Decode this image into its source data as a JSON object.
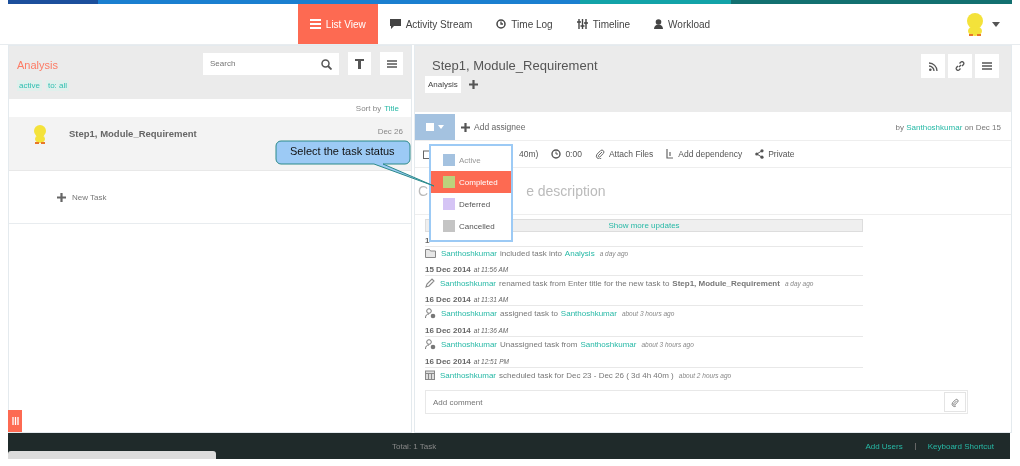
{
  "nav": {
    "tabs": [
      {
        "label": "List View",
        "selected": true
      },
      {
        "label": "Activity Stream",
        "selected": false
      },
      {
        "label": "Time Log",
        "selected": false
      },
      {
        "label": "Timeline",
        "selected": false
      },
      {
        "label": "Workload",
        "selected": false
      }
    ]
  },
  "list_panel": {
    "title": "Analysis",
    "search": {
      "placeholder": "Search"
    },
    "filters": [
      "active",
      "to: all"
    ],
    "sort": {
      "label": "Sort by",
      "value": "Title"
    },
    "tasks": [
      {
        "title": "Step1, Module_Requirement",
        "date": "Dec 26",
        "selected": true
      }
    ],
    "new_task": "New Task"
  },
  "task": {
    "title": "Step1, Module_Requirement",
    "tags": [
      "Analysis"
    ],
    "status_checked": false,
    "status_menu": {
      "items": [
        {
          "label": "Active",
          "color": "#a4c2e0",
          "selected": false
        },
        {
          "label": "Completed",
          "color": "#bcd27c",
          "selected": true
        },
        {
          "label": "Deferred",
          "color": "#d5c4f5",
          "selected": false
        },
        {
          "label": "Cancelled",
          "color": "#c4c4c4",
          "selected": false
        }
      ]
    },
    "add_assignee": "Add assignee",
    "created": {
      "prefix": "by",
      "user": "Santhoshkumar",
      "suffix": "on Dec 15"
    },
    "meta": [
      {
        "kind": "schedule",
        "label": "40m)"
      },
      {
        "kind": "time",
        "label": "0:00"
      },
      {
        "kind": "attach",
        "label": "Attach Files"
      },
      {
        "kind": "dependency",
        "label": "Add dependency"
      },
      {
        "kind": "private",
        "label": "Private"
      }
    ],
    "description_fragments": [
      "C",
      "e description"
    ],
    "show_more": "Show more updates",
    "activity": [
      {
        "date": "1",
        "kind": "folder",
        "parts": [
          {
            "kind": "user",
            "text": "Santhoshkumar"
          },
          {
            "kind": "text",
            "text": "included task into"
          },
          {
            "kind": "link",
            "text": "Analysis"
          },
          {
            "kind": "ago",
            "text": "a day ago"
          }
        ]
      },
      {
        "date": "15 Dec 2014",
        "time": "at 11:56 AM",
        "kind": "pencil",
        "parts": [
          {
            "kind": "user",
            "text": "Santhoshkumar"
          },
          {
            "kind": "text",
            "text": "renamed task from Enter title for the new task to"
          },
          {
            "kind": "bold",
            "text": "Step1, Module_Requirement"
          },
          {
            "kind": "ago",
            "text": "a day ago"
          }
        ]
      },
      {
        "date": "16 Dec 2014",
        "time": "at 11:31 AM",
        "kind": "assign",
        "parts": [
          {
            "kind": "user",
            "text": "Santhoshkumar"
          },
          {
            "kind": "text",
            "text": "assigned task to"
          },
          {
            "kind": "user",
            "text": "Santhoshkumar"
          },
          {
            "kind": "ago",
            "text": "about 3 hours ago"
          }
        ]
      },
      {
        "date": "16 Dec 2014",
        "time": "at 11:36 AM",
        "kind": "assign",
        "parts": [
          {
            "kind": "user",
            "text": "Santhoshkumar"
          },
          {
            "kind": "text",
            "text": "Unassigned task from"
          },
          {
            "kind": "user",
            "text": "Santhoshkumar"
          },
          {
            "kind": "ago",
            "text": "about 3 hours ago"
          }
        ]
      },
      {
        "date": "16 Dec 2014",
        "time": "at 12:51 PM",
        "kind": "calendar",
        "parts": [
          {
            "kind": "user",
            "text": "Santhoshkumar"
          },
          {
            "kind": "text",
            "text": "scheduled task for Dec 23 - Dec 26 ( 3d 4h 40m )"
          },
          {
            "kind": "ago",
            "text": "about 2 hours ago"
          }
        ]
      }
    ],
    "comment": {
      "placeholder": "Add comment"
    }
  },
  "callout": "Select the task status",
  "footer": {
    "total": "Total: 1 Task",
    "links": [
      "Add Users",
      "Keyboard Shortcut"
    ]
  }
}
